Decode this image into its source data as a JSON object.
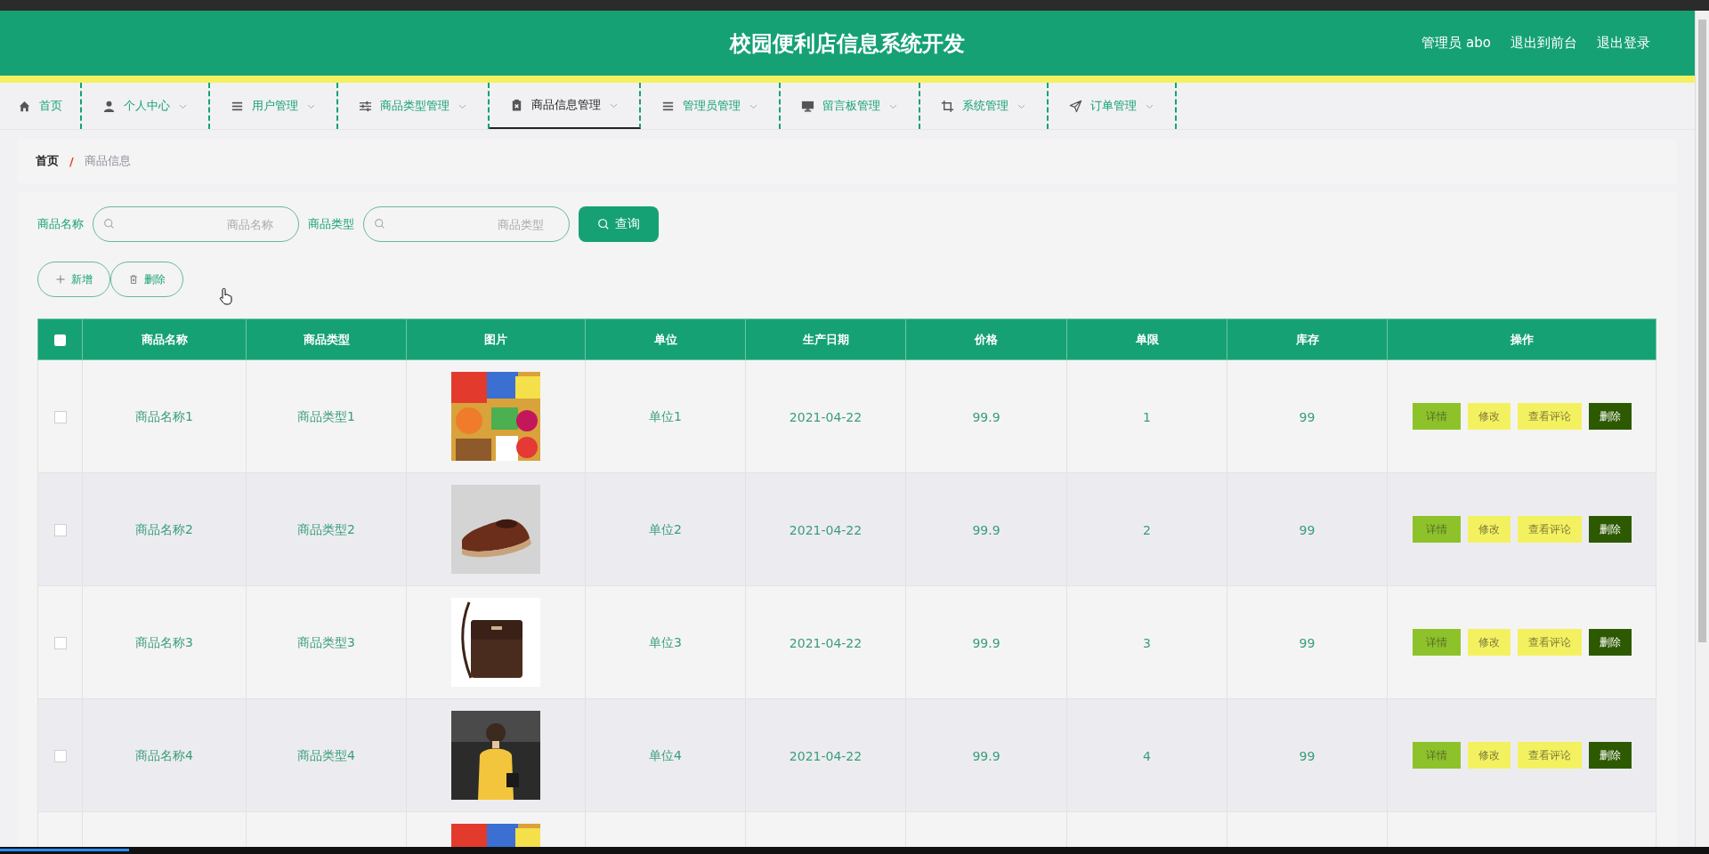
{
  "header": {
    "title": "校园便利店信息系统开发",
    "links": [
      "管理员 abo",
      "退出到前台",
      "退出登录"
    ]
  },
  "nav": [
    {
      "label": "首页",
      "dropdown": false,
      "selected": false
    },
    {
      "label": "个人中心",
      "dropdown": true,
      "selected": false
    },
    {
      "label": "用户管理",
      "dropdown": true,
      "selected": false
    },
    {
      "label": "商品类型管理",
      "dropdown": true,
      "selected": false
    },
    {
      "label": "商品信息管理",
      "dropdown": true,
      "selected": true
    },
    {
      "label": "管理员管理",
      "dropdown": true,
      "selected": false
    },
    {
      "label": "留言板管理",
      "dropdown": true,
      "selected": false
    },
    {
      "label": "系统管理",
      "dropdown": true,
      "selected": false
    },
    {
      "label": "订单管理",
      "dropdown": true,
      "selected": false
    }
  ],
  "breadcrumb": {
    "items": [
      "首页",
      "商品信息"
    ],
    "separator": "/"
  },
  "search": {
    "fields": [
      {
        "label": "商品名称",
        "placeholder": "商品名称"
      },
      {
        "label": "商品类型",
        "placeholder": "商品类型"
      }
    ],
    "button": "查询"
  },
  "actions": [
    {
      "label": "新增",
      "kind": "add"
    },
    {
      "label": "删除",
      "kind": "delete"
    }
  ],
  "table": {
    "header_checkbox": {
      "checked": false
    },
    "columns": [
      "商品名称",
      "商品类型",
      "图片",
      "单位",
      "生产日期",
      "价格",
      "单限",
      "库存",
      "操作"
    ],
    "rows": [
      {
        "checked": false,
        "name": "商品名称1",
        "type": "商品类型1",
        "image": {
          "kind": "picture"
        },
        "unit": "单位1",
        "date": "2021-04-22",
        "price": "99.9",
        "limit": "1",
        "stock": "99",
        "buttons": [
          "详情",
          "修改",
          "查看评论",
          "删除"
        ]
      },
      {
        "checked": false,
        "name": "商品名称2",
        "type": "商品类型2",
        "image": {
          "kind": "picture"
        },
        "unit": "单位2",
        "date": "2021-04-22",
        "price": "99.9",
        "limit": "2",
        "stock": "99",
        "buttons": [
          "详情",
          "修改",
          "查看评论",
          "删除"
        ]
      },
      {
        "checked": false,
        "name": "商品名称3",
        "type": "商品类型3",
        "image": {
          "kind": "picture"
        },
        "unit": "单位3",
        "date": "2021-04-22",
        "price": "99.9",
        "limit": "3",
        "stock": "99",
        "buttons": [
          "详情",
          "修改",
          "查看评论",
          "删除"
        ]
      },
      {
        "checked": false,
        "name": "商品名称4",
        "type": "商品类型4",
        "image": {
          "kind": "picture"
        },
        "unit": "单位4",
        "date": "2021-04-22",
        "price": "99.9",
        "limit": "4",
        "stock": "99",
        "buttons": [
          "详情",
          "修改",
          "查看评论",
          "删除"
        ]
      },
      {
        "image": {
          "kind": "picture"
        }
      }
    ]
  }
}
